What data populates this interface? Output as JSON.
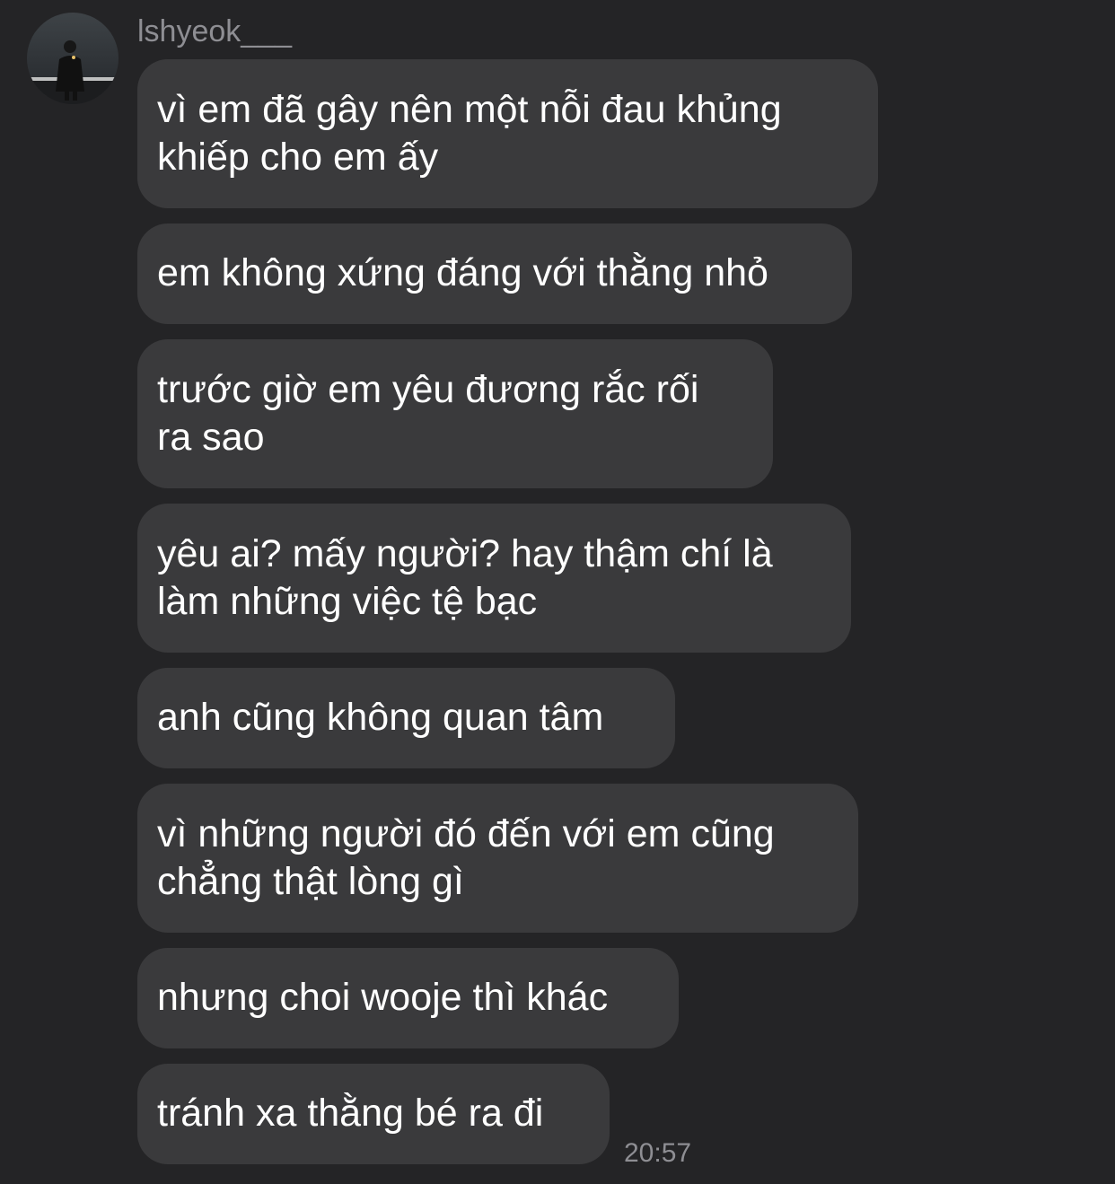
{
  "sender": {
    "name": "lshyeok___"
  },
  "messages": [
    {
      "lines": [
        "vì em đã gây nên một nỗi đau khủng",
        "khiếp cho em ấy"
      ]
    },
    {
      "lines": [
        "em không xứng đáng với thằng nhỏ"
      ]
    },
    {
      "lines": [
        "trước giờ em yêu đương rắc rối",
        "ra sao"
      ]
    },
    {
      "lines": [
        "yêu ai? mấy người? hay thậm chí là",
        "làm những việc tệ bạc"
      ]
    },
    {
      "lines": [
        "anh cũng không quan tâm"
      ]
    },
    {
      "lines": [
        "vì những người đó đến với em cũng",
        "chẳng thật lòng gì"
      ]
    },
    {
      "lines": [
        "nhưng choi wooje thì khác"
      ]
    },
    {
      "lines": [
        "tránh xa thằng bé ra đi"
      ]
    }
  ],
  "timestamp": "20:57",
  "colors": {
    "background": "#242426",
    "bubble": "#3a3a3c",
    "message_text": "#ffffff",
    "meta_text": "#8e8e93"
  }
}
